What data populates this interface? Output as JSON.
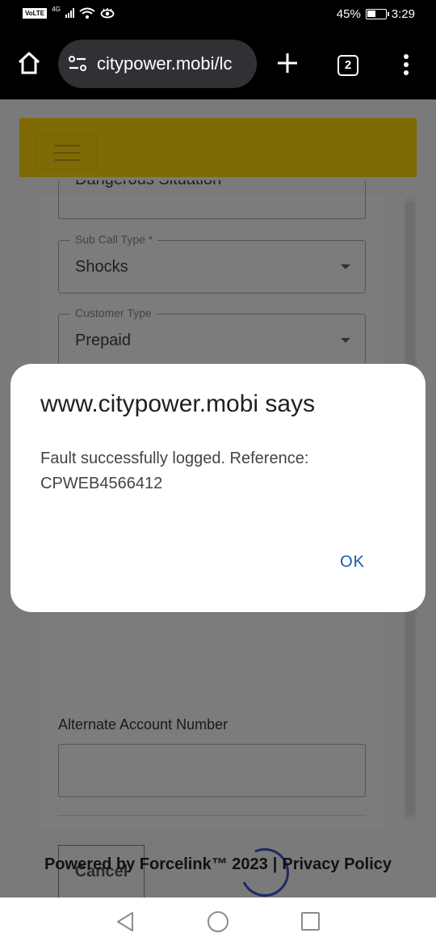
{
  "status_bar": {
    "volte": "VoLTE",
    "network": "4G",
    "battery_percent": "45%",
    "time": "3:29"
  },
  "browser": {
    "url": "citypower.mobi/lc",
    "tab_count": "2"
  },
  "form": {
    "partial_field_value": "Dangerous Situation",
    "sub_call_type": {
      "label": "Sub Call Type *",
      "value": "Shocks"
    },
    "customer_type": {
      "label": "Customer Type",
      "value": "Prepaid"
    },
    "alt_account_label": "Alternate Account Number",
    "alt_account_value": "",
    "cancel_label": "Cancel"
  },
  "footer": {
    "powered_by": "Powered by Forcelink™ 2023",
    "separator": "|",
    "privacy": "Privacy Policy"
  },
  "dialog": {
    "title": "www.citypower.mobi says",
    "message": "Fault successfully logged. Reference: CPWEB4566412",
    "ok_label": "OK"
  },
  "colors": {
    "banner_dimmed": "#7f6a05",
    "ok_blue": "#1a57b5",
    "spinner": "#1d2a66"
  }
}
